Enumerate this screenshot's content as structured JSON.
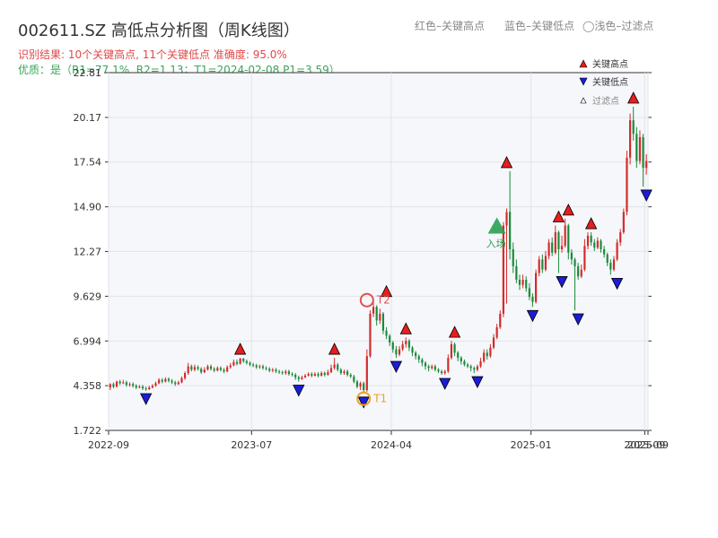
{
  "header": {
    "title": "002611.SZ 高低点分析图（周K线图）",
    "result_line": "识别结果: 10个关键高点, 11个关键低点  准确度: 95.0%",
    "quality_line": "优质：是（R1=77.1%, R2=1.13；T1=2024-02-08 P1=3.59）",
    "legend_red": "红色–关键高点",
    "legend_blue": "蓝色–关键低点",
    "legend_light": "◯浅色–过滤点"
  },
  "colors": {
    "up": "#d42a2a",
    "down": "#1a8a3a",
    "peak": "#e61e1e",
    "trough": "#1c1cd6",
    "t_marker_red": "#e05050",
    "t_marker_orange": "#f0a020",
    "entry": "#2aa050",
    "plot_bg": "#f5f7fa"
  },
  "chart_data": {
    "type": "candlestick",
    "title": "002611.SZ 高低点分析图（周K线图）",
    "y_ticks": [
      "1.722",
      "4.358",
      "6.994",
      "9.629",
      "12.27",
      "14.90",
      "17.54",
      "20.17",
      "22.81"
    ],
    "ylim": [
      1.722,
      22.81
    ],
    "x_ticks": [
      {
        "label": "2022-09",
        "index": 0
      },
      {
        "label": "2023-07",
        "index": 44
      },
      {
        "label": "2024-04",
        "index": 87
      },
      {
        "label": "2025-01",
        "index": 130
      },
      {
        "label": "2025-09",
        "index": 165
      },
      {
        "label": "2025-09",
        "index": 166
      }
    ],
    "total_bars": 166,
    "key_points": [
      {
        "kind": "low",
        "index": 11,
        "price": 4.1
      },
      {
        "kind": "high",
        "index": 40,
        "price": 6.0
      },
      {
        "kind": "low",
        "index": 58,
        "price": 4.6
      },
      {
        "kind": "high",
        "index": 69,
        "price": 6.0
      },
      {
        "kind": "low",
        "index": 78,
        "price": 3.9
      },
      {
        "kind": "high",
        "index": 85,
        "price": 9.4
      },
      {
        "kind": "low",
        "index": 88,
        "price": 6.0
      },
      {
        "kind": "high",
        "index": 91,
        "price": 7.2
      },
      {
        "kind": "low",
        "index": 103,
        "price": 5.0
      },
      {
        "kind": "high",
        "index": 106,
        "price": 7.0
      },
      {
        "kind": "low",
        "index": 113,
        "price": 5.1
      },
      {
        "kind": "high",
        "index": 122,
        "price": 17.0
      },
      {
        "kind": "low",
        "index": 130,
        "price": 9.0
      },
      {
        "kind": "high",
        "index": 138,
        "price": 13.8
      },
      {
        "kind": "low",
        "index": 139,
        "price": 11.0
      },
      {
        "kind": "high",
        "index": 141,
        "price": 14.2
      },
      {
        "kind": "low",
        "index": 144,
        "price": 8.8
      },
      {
        "kind": "high",
        "index": 148,
        "price": 13.4
      },
      {
        "kind": "low",
        "index": 156,
        "price": 10.9
      },
      {
        "kind": "high",
        "index": 161,
        "price": 20.8
      },
      {
        "kind": "low",
        "index": 165,
        "price": 16.1
      }
    ],
    "t_markers": [
      {
        "label": "T1",
        "index": 78,
        "price": 3.59
      },
      {
        "label": "T2",
        "index": 79,
        "price": 9.4
      }
    ],
    "entry_marker": {
      "label": "入场",
      "index": 119,
      "price": 13.8
    },
    "legend": [
      "关键高点",
      "关键低点",
      "过滤点"
    ],
    "candles": [
      [
        4.25,
        4.45,
        4.1,
        4.5
      ],
      [
        4.45,
        4.3,
        4.2,
        4.55
      ],
      [
        4.3,
        4.6,
        4.25,
        4.65
      ],
      [
        4.6,
        4.5,
        4.4,
        4.7
      ],
      [
        4.5,
        4.55,
        4.45,
        4.7
      ],
      [
        4.55,
        4.4,
        4.3,
        4.65
      ],
      [
        4.4,
        4.45,
        4.3,
        4.55
      ],
      [
        4.45,
        4.35,
        4.25,
        4.55
      ],
      [
        4.35,
        4.25,
        4.15,
        4.45
      ],
      [
        4.25,
        4.3,
        4.2,
        4.4
      ],
      [
        4.3,
        4.2,
        4.1,
        4.4
      ],
      [
        4.2,
        4.15,
        4.05,
        4.3
      ],
      [
        4.15,
        4.25,
        4.1,
        4.35
      ],
      [
        4.25,
        4.35,
        4.2,
        4.45
      ],
      [
        4.35,
        4.5,
        4.3,
        4.6
      ],
      [
        4.5,
        4.7,
        4.45,
        4.8
      ],
      [
        4.7,
        4.6,
        4.5,
        4.8
      ],
      [
        4.6,
        4.75,
        4.55,
        4.85
      ],
      [
        4.75,
        4.65,
        4.55,
        4.85
      ],
      [
        4.65,
        4.55,
        4.45,
        4.75
      ],
      [
        4.55,
        4.45,
        4.35,
        4.65
      ],
      [
        4.45,
        4.55,
        4.4,
        4.65
      ],
      [
        4.55,
        4.8,
        4.5,
        4.9
      ],
      [
        4.8,
        5.1,
        4.7,
        5.2
      ],
      [
        5.1,
        5.5,
        5.0,
        5.7
      ],
      [
        5.5,
        5.3,
        5.2,
        5.6
      ],
      [
        5.3,
        5.45,
        5.2,
        5.6
      ],
      [
        5.45,
        5.35,
        5.25,
        5.55
      ],
      [
        5.35,
        5.15,
        5.05,
        5.45
      ],
      [
        5.15,
        5.3,
        5.1,
        5.45
      ],
      [
        5.3,
        5.5,
        5.25,
        5.6
      ],
      [
        5.5,
        5.35,
        5.25,
        5.6
      ],
      [
        5.35,
        5.25,
        5.15,
        5.45
      ],
      [
        5.25,
        5.4,
        5.2,
        5.5
      ],
      [
        5.4,
        5.3,
        5.2,
        5.5
      ],
      [
        5.3,
        5.2,
        5.1,
        5.4
      ],
      [
        5.2,
        5.45,
        5.15,
        5.55
      ],
      [
        5.45,
        5.55,
        5.35,
        5.7
      ],
      [
        5.55,
        5.75,
        5.5,
        5.9
      ],
      [
        5.75,
        5.65,
        5.55,
        5.9
      ],
      [
        5.65,
        5.95,
        5.6,
        6.0
      ],
      [
        5.95,
        5.8,
        5.7,
        6.0
      ],
      [
        5.8,
        5.7,
        5.6,
        5.9
      ],
      [
        5.7,
        5.6,
        5.5,
        5.8
      ],
      [
        5.6,
        5.55,
        5.45,
        5.7
      ],
      [
        5.55,
        5.45,
        5.35,
        5.65
      ],
      [
        5.45,
        5.5,
        5.35,
        5.6
      ],
      [
        5.5,
        5.4,
        5.3,
        5.6
      ],
      [
        5.4,
        5.35,
        5.25,
        5.5
      ],
      [
        5.35,
        5.25,
        5.15,
        5.45
      ],
      [
        5.25,
        5.3,
        5.15,
        5.4
      ],
      [
        5.3,
        5.2,
        5.1,
        5.4
      ],
      [
        5.2,
        5.15,
        5.05,
        5.3
      ],
      [
        5.15,
        5.1,
        5.0,
        5.25
      ],
      [
        5.1,
        5.2,
        5.0,
        5.3
      ],
      [
        5.2,
        5.05,
        4.95,
        5.3
      ],
      [
        5.05,
        5.0,
        4.9,
        5.15
      ],
      [
        5.0,
        4.85,
        4.7,
        5.1
      ],
      [
        4.85,
        4.75,
        4.6,
        4.95
      ],
      [
        4.75,
        4.85,
        4.7,
        4.95
      ],
      [
        4.85,
        4.95,
        4.8,
        5.05
      ],
      [
        4.95,
        5.05,
        4.9,
        5.15
      ],
      [
        5.05,
        4.95,
        4.85,
        5.15
      ],
      [
        4.95,
        5.05,
        4.9,
        5.15
      ],
      [
        5.05,
        4.95,
        4.85,
        5.15
      ],
      [
        4.95,
        5.1,
        4.9,
        5.2
      ],
      [
        5.1,
        5.0,
        4.9,
        5.2
      ],
      [
        5.0,
        5.15,
        4.95,
        5.3
      ],
      [
        5.15,
        5.4,
        5.1,
        5.6
      ],
      [
        5.4,
        5.6,
        5.3,
        6.0
      ],
      [
        5.6,
        5.3,
        5.2,
        5.7
      ],
      [
        5.3,
        5.1,
        5.0,
        5.4
      ],
      [
        5.1,
        5.2,
        5.0,
        5.3
      ],
      [
        5.2,
        5.0,
        4.9,
        5.3
      ],
      [
        5.0,
        4.9,
        4.8,
        5.1
      ],
      [
        4.9,
        4.6,
        4.5,
        5.0
      ],
      [
        4.6,
        4.3,
        4.2,
        4.7
      ],
      [
        4.3,
        4.5,
        4.1,
        4.6
      ],
      [
        4.5,
        4.1,
        3.9,
        4.6
      ],
      [
        4.1,
        6.1,
        4.0,
        6.5
      ],
      [
        6.1,
        8.6,
        6.0,
        8.8
      ],
      [
        8.6,
        9.0,
        8.4,
        9.4
      ],
      [
        9.0,
        8.2,
        7.9,
        9.1
      ],
      [
        8.2,
        8.6,
        8.0,
        8.9
      ],
      [
        8.6,
        7.6,
        7.4,
        8.7
      ],
      [
        7.6,
        7.3,
        7.1,
        7.8
      ],
      [
        7.3,
        6.9,
        6.7,
        7.4
      ],
      [
        6.9,
        6.5,
        6.3,
        7.0
      ],
      [
        6.5,
        6.2,
        6.0,
        6.7
      ],
      [
        6.2,
        6.5,
        6.1,
        6.7
      ],
      [
        6.5,
        6.8,
        6.4,
        7.0
      ],
      [
        6.8,
        7.0,
        6.6,
        7.2
      ],
      [
        7.0,
        6.6,
        6.4,
        7.1
      ],
      [
        6.6,
        6.3,
        6.1,
        6.7
      ],
      [
        6.3,
        6.1,
        5.9,
        6.4
      ],
      [
        6.1,
        5.9,
        5.7,
        6.2
      ],
      [
        5.9,
        5.7,
        5.5,
        6.0
      ],
      [
        5.7,
        5.5,
        5.3,
        5.8
      ],
      [
        5.5,
        5.4,
        5.2,
        5.6
      ],
      [
        5.4,
        5.5,
        5.3,
        5.6
      ],
      [
        5.5,
        5.3,
        5.2,
        5.6
      ],
      [
        5.3,
        5.2,
        5.1,
        5.4
      ],
      [
        5.2,
        5.1,
        5.0,
        5.3
      ],
      [
        5.1,
        5.2,
        5.0,
        5.3
      ],
      [
        5.2,
        6.0,
        5.1,
        6.2
      ],
      [
        6.0,
        6.8,
        5.9,
        7.0
      ],
      [
        6.8,
        6.3,
        6.1,
        6.9
      ],
      [
        6.3,
        6.0,
        5.8,
        6.4
      ],
      [
        6.0,
        5.8,
        5.6,
        6.1
      ],
      [
        5.8,
        5.6,
        5.5,
        5.9
      ],
      [
        5.6,
        5.5,
        5.4,
        5.7
      ],
      [
        5.5,
        5.4,
        5.2,
        5.6
      ],
      [
        5.4,
        5.3,
        5.1,
        5.5
      ],
      [
        5.3,
        5.5,
        5.2,
        5.6
      ],
      [
        5.5,
        5.8,
        5.4,
        6.0
      ],
      [
        5.8,
        6.3,
        5.7,
        6.5
      ],
      [
        6.3,
        6.1,
        5.9,
        6.5
      ],
      [
        6.1,
        6.6,
        6.0,
        6.8
      ],
      [
        6.6,
        7.2,
        6.5,
        7.4
      ],
      [
        7.2,
        7.8,
        7.1,
        8.0
      ],
      [
        7.8,
        8.6,
        7.7,
        8.8
      ],
      [
        8.6,
        13.8,
        8.4,
        14.0
      ],
      [
        13.8,
        14.6,
        9.2,
        14.8
      ],
      [
        14.6,
        12.4,
        11.8,
        17.0
      ],
      [
        12.4,
        11.4,
        11.0,
        12.8
      ],
      [
        11.4,
        10.6,
        10.4,
        11.8
      ],
      [
        10.6,
        10.3,
        10.0,
        10.9
      ],
      [
        10.3,
        10.6,
        10.1,
        10.9
      ],
      [
        10.6,
        10.1,
        9.9,
        10.8
      ],
      [
        10.1,
        9.6,
        9.4,
        10.4
      ],
      [
        9.6,
        9.3,
        9.0,
        9.8
      ],
      [
        9.3,
        11.0,
        9.2,
        11.2
      ],
      [
        11.0,
        11.8,
        10.8,
        12.0
      ],
      [
        11.8,
        11.2,
        11.0,
        12.1
      ],
      [
        11.2,
        12.0,
        11.1,
        12.3
      ],
      [
        12.0,
        12.8,
        11.8,
        13.0
      ],
      [
        12.8,
        12.2,
        12.0,
        13.1
      ],
      [
        12.2,
        13.4,
        12.1,
        13.8
      ],
      [
        13.4,
        12.4,
        11.0,
        13.5
      ],
      [
        12.4,
        12.6,
        12.2,
        13.2
      ],
      [
        12.6,
        13.8,
        12.5,
        14.2
      ],
      [
        13.8,
        12.2,
        11.8,
        13.9
      ],
      [
        12.2,
        11.8,
        11.5,
        12.4
      ],
      [
        11.8,
        11.4,
        8.8,
        11.9
      ],
      [
        11.4,
        10.8,
        10.6,
        11.6
      ],
      [
        10.8,
        11.2,
        10.7,
        11.5
      ],
      [
        11.2,
        12.6,
        11.1,
        13.0
      ],
      [
        12.6,
        13.2,
        12.4,
        13.4
      ],
      [
        13.2,
        12.8,
        12.6,
        13.4
      ],
      [
        12.8,
        12.5,
        12.3,
        13.0
      ],
      [
        12.5,
        12.9,
        12.4,
        13.1
      ],
      [
        12.9,
        12.4,
        12.2,
        13.0
      ],
      [
        12.4,
        12.1,
        11.9,
        12.6
      ],
      [
        12.1,
        11.6,
        11.4,
        12.2
      ],
      [
        11.6,
        11.2,
        10.9,
        11.8
      ],
      [
        11.2,
        11.8,
        11.1,
        12.0
      ],
      [
        11.8,
        12.8,
        11.7,
        13.0
      ],
      [
        12.8,
        13.4,
        12.6,
        13.6
      ],
      [
        13.4,
        14.6,
        13.3,
        14.8
      ],
      [
        14.6,
        17.8,
        14.4,
        18.2
      ],
      [
        17.8,
        20.0,
        17.4,
        20.4
      ],
      [
        20.0,
        19.2,
        18.8,
        20.8
      ],
      [
        19.2,
        17.6,
        17.2,
        19.6
      ],
      [
        17.6,
        19.0,
        17.4,
        19.4
      ],
      [
        19.0,
        17.2,
        16.1,
        19.2
      ],
      [
        17.2,
        17.6,
        16.8,
        18.0
      ]
    ]
  }
}
